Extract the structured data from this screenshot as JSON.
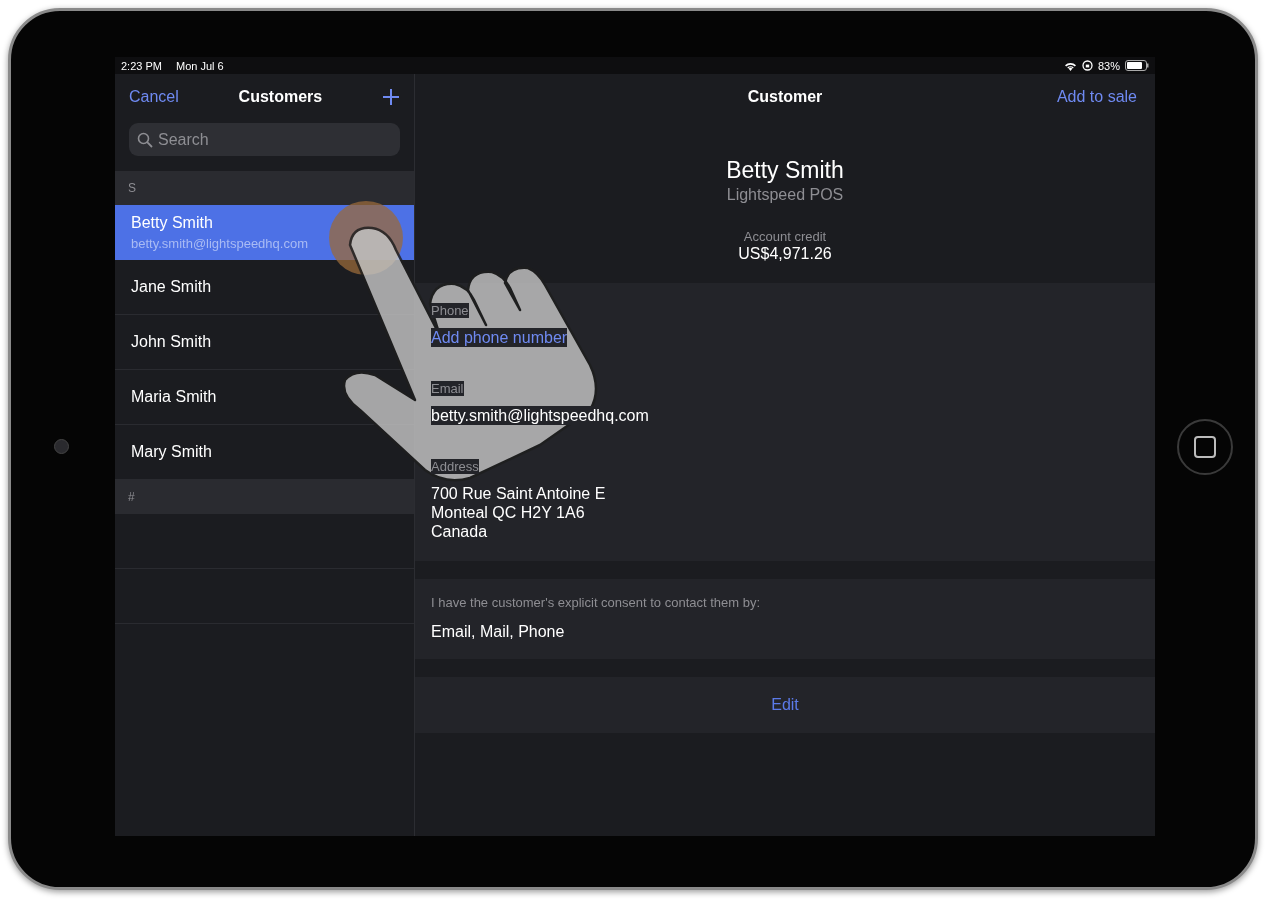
{
  "status_bar": {
    "time": "2:23 PM",
    "date": "Mon Jul 6",
    "battery": "83%"
  },
  "customer_list": {
    "cancel": "Cancel",
    "title": "Customers",
    "search": {
      "placeholder": "Search"
    },
    "sections": [
      {
        "letter": "S",
        "customers": [
          {
            "name": "Betty Smith",
            "email": "betty.smith@lightspeedhq.com",
            "selected": true
          },
          {
            "name": "Jane Smith",
            "selected": false
          },
          {
            "name": "John Smith",
            "selected": false
          },
          {
            "name": "Maria Smith",
            "selected": false
          },
          {
            "name": "Mary Smith",
            "selected": false
          }
        ]
      },
      {
        "letter": "#"
      }
    ]
  },
  "detail": {
    "title": "Customer",
    "action": "Add to sale",
    "name": "Betty Smith",
    "company": "Lightspeed POS",
    "credit_label": "Account credit",
    "credit": "US$4,971.26",
    "fields": [
      {
        "label": "Phone",
        "kind": "action",
        "lines": [
          "Add phone number"
        ]
      },
      {
        "label": "Email",
        "kind": "text",
        "lines": [
          "betty.smith@lightspeedhq.com"
        ]
      },
      {
        "label": "Address",
        "kind": "text",
        "lines": [
          "700 Rue Saint Antoine E",
          "Monteal QC H2Y 1A6",
          "Canada"
        ]
      }
    ],
    "consent": {
      "label": "I have the customer's explicit consent to contact them by:",
      "value": "Email, Mail, Phone"
    },
    "edit": "Edit"
  }
}
